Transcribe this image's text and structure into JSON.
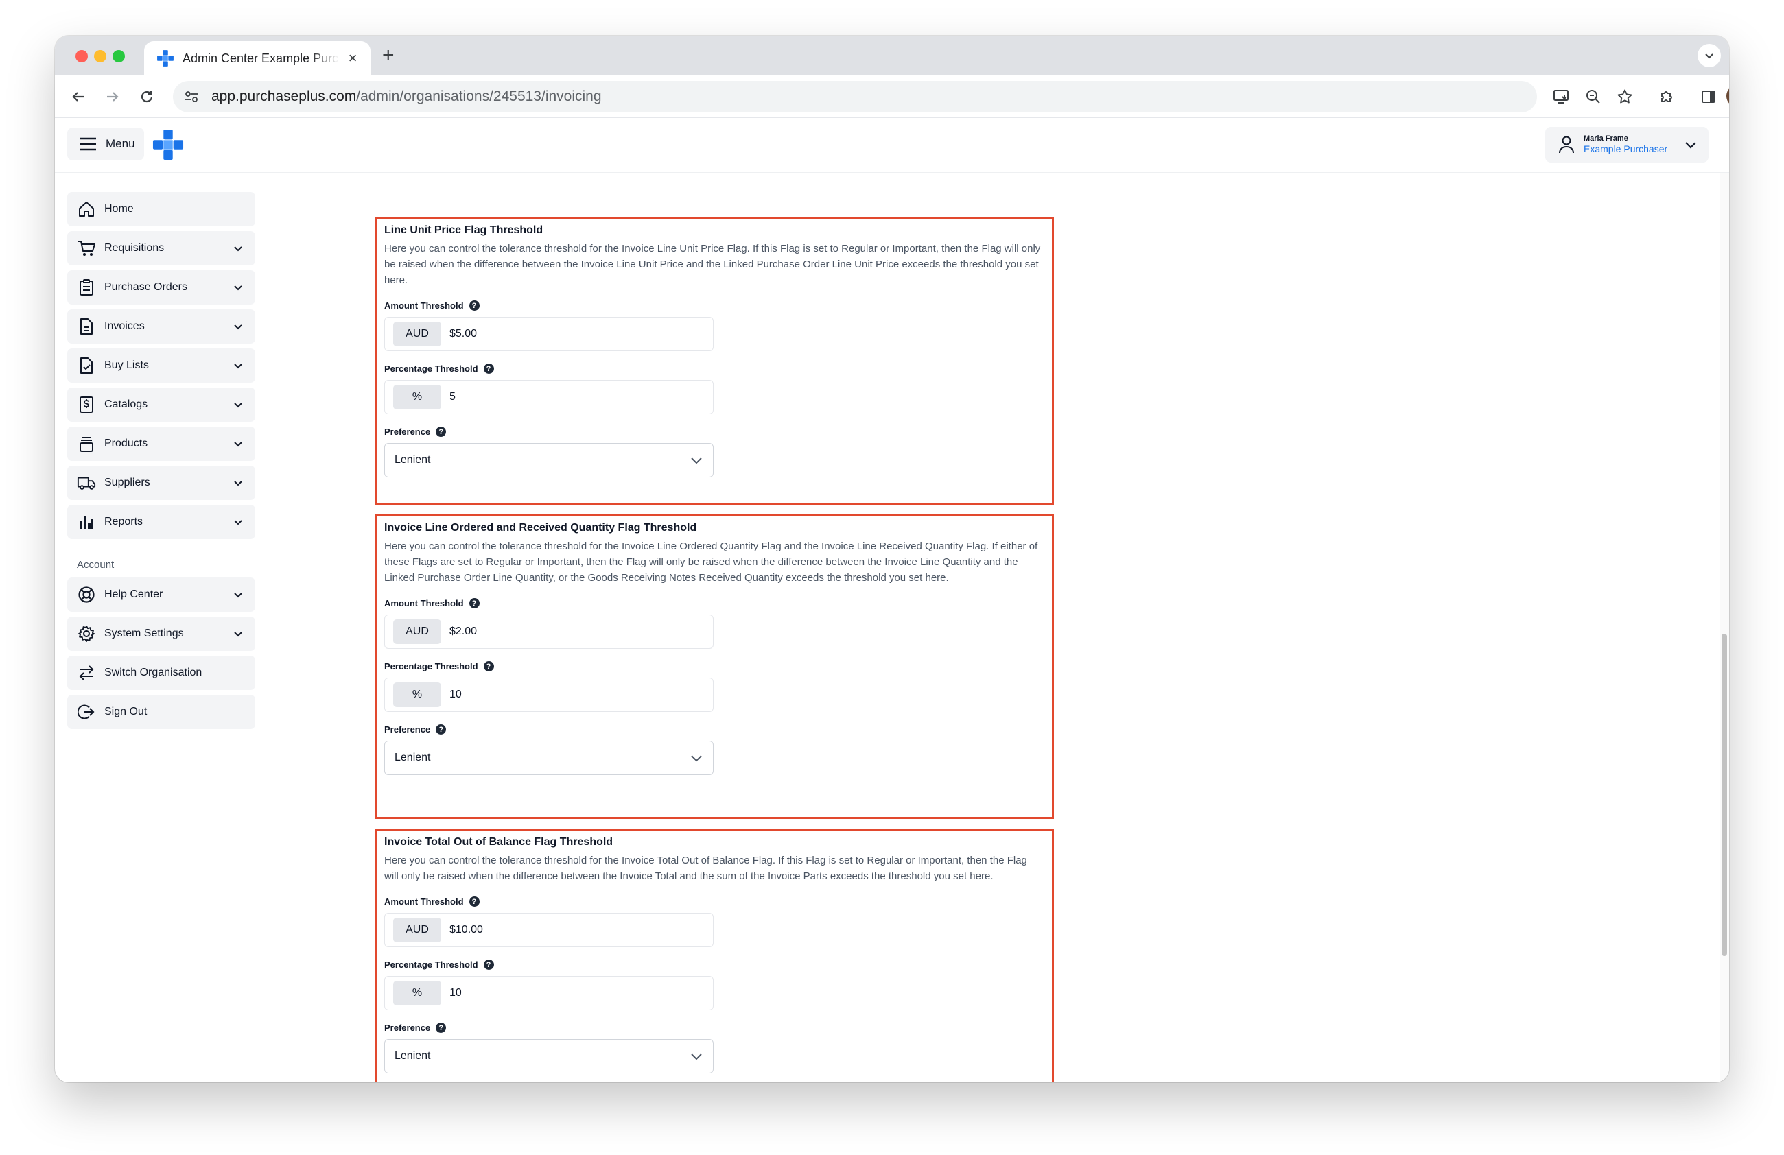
{
  "browser": {
    "tab_title": "Admin Center Example Purchaser",
    "tab_close": "×",
    "new_tab": "+",
    "url_host": "app.purchaseplus.com",
    "url_path": "/admin/organisations/245513/invoicing"
  },
  "header": {
    "menu_label": "Menu",
    "user_name": "Maria Frame",
    "user_org": "Example Purchaser",
    "brand_color": "#1a73e8"
  },
  "sidebar": {
    "items": [
      {
        "label": "Home",
        "icon": "home-icon",
        "expandable": false
      },
      {
        "label": "Requisitions",
        "icon": "cart-icon",
        "expandable": true
      },
      {
        "label": "Purchase Orders",
        "icon": "clipboard-icon",
        "expandable": true
      },
      {
        "label": "Invoices",
        "icon": "document-icon",
        "expandable": true
      },
      {
        "label": "Buy Lists",
        "icon": "checklist-icon",
        "expandable": true
      },
      {
        "label": "Catalogs",
        "icon": "dollar-document-icon",
        "expandable": true
      },
      {
        "label": "Products",
        "icon": "stack-icon",
        "expandable": true
      },
      {
        "label": "Suppliers",
        "icon": "truck-icon",
        "expandable": true
      },
      {
        "label": "Reports",
        "icon": "bar-chart-icon",
        "expandable": true
      }
    ],
    "account_heading": "Account",
    "account_items": [
      {
        "label": "Help Center",
        "icon": "lifebuoy-icon",
        "expandable": true
      },
      {
        "label": "System Settings",
        "icon": "gear-icon",
        "expandable": true
      },
      {
        "label": "Switch Organisation",
        "icon": "switch-arrows-icon",
        "expandable": false
      },
      {
        "label": "Sign Out",
        "icon": "sign-out-icon",
        "expandable": false
      }
    ]
  },
  "sections": [
    {
      "title": "Line Unit Price Flag Threshold",
      "description": "Here you can control the tolerance threshold for the Invoice Line Unit Price Flag. If this Flag is set to Regular or Important, then the Flag will only be raised when the difference between the Invoice Line Unit Price and the Linked Purchase Order Line Unit Price exceeds the threshold you set here.",
      "amount_label": "Amount Threshold",
      "amount_currency": "AUD",
      "amount_value": "$5.00",
      "percentage_label": "Percentage Threshold",
      "percentage_symbol": "%",
      "percentage_value": "5",
      "preference_label": "Preference",
      "preference_value": "Lenient"
    },
    {
      "title": "Invoice Line Ordered and Received Quantity Flag Threshold",
      "description": "Here you can control the tolerance threshold for the Invoice Line Ordered Quantity Flag and the Invoice Line Received Quantity Flag. If either of these Flags are set to Regular or Important, then the Flag will only be raised when the difference between the Invoice Line Quantity and the Linked Purchase Order Line Quantity, or the Goods Receiving Notes Received Quantity exceeds the threshold you set here.",
      "amount_label": "Amount Threshold",
      "amount_currency": "AUD",
      "amount_value": "$2.00",
      "percentage_label": "Percentage Threshold",
      "percentage_symbol": "%",
      "percentage_value": "10",
      "preference_label": "Preference",
      "preference_value": "Lenient"
    },
    {
      "title": "Invoice Total Out of Balance Flag Threshold",
      "description": "Here you can control the tolerance threshold for the Invoice Total Out of Balance Flag. If this Flag is set to Regular or Important, then the Flag will only be raised when the difference between the Invoice Total and the sum of the Invoice Parts exceeds the threshold you set here.",
      "amount_label": "Amount Threshold",
      "amount_currency": "AUD",
      "amount_value": "$10.00",
      "percentage_label": "Percentage Threshold",
      "percentage_symbol": "%",
      "percentage_value": "10",
      "preference_label": "Preference",
      "preference_value": "Lenient"
    }
  ],
  "highlight_color": "#e2492e",
  "help_glyph": "?"
}
